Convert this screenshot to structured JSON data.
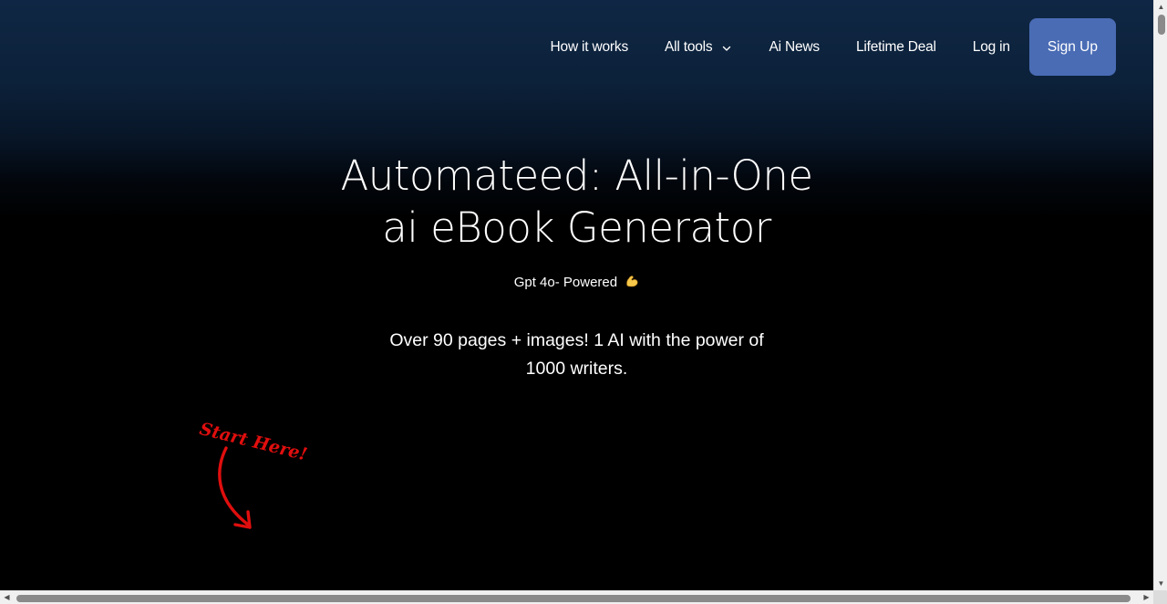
{
  "nav": {
    "items": [
      {
        "label": "How it works"
      },
      {
        "label": "All tools",
        "icon": "chevron-down-icon"
      },
      {
        "label": "Ai News"
      },
      {
        "label": "Lifetime Deal"
      },
      {
        "label": "Log in"
      }
    ],
    "signup_label": "Sign Up"
  },
  "hero": {
    "title_line1": "Automateed: All-in-One",
    "title_line2": "ai eBook Generator",
    "powered": "Gpt 4o- Powered",
    "powered_icon": "flexed-biceps-icon",
    "tagline_line1": "Over 90 pages + images! 1 AI with the power of",
    "tagline_line2": "1000 writers."
  },
  "callout": {
    "text": "Start Here!",
    "icon": "curved-arrow-down-icon"
  },
  "colors": {
    "accent": "#4a6cb5",
    "callout": "#e00e0e",
    "header_gradient_top": "#0f2744",
    "background": "#000000"
  }
}
